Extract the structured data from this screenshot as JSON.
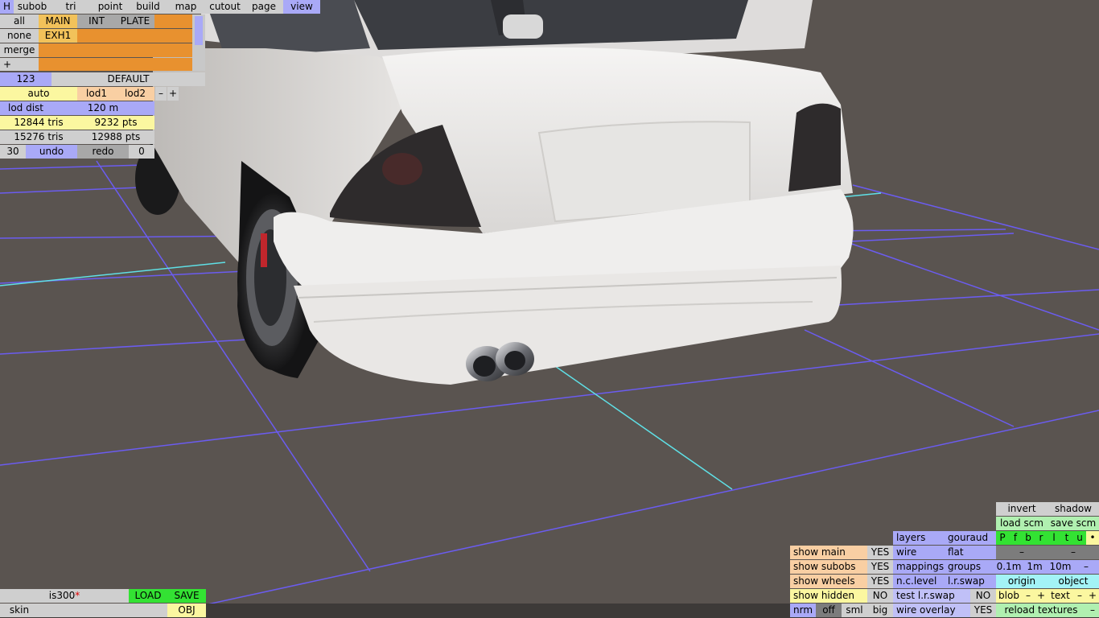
{
  "toolbar": {
    "h": "H",
    "subob": "subob",
    "tri": "tri",
    "point": "point",
    "build": "build",
    "map": "map",
    "cutout": "cutout",
    "page": "page",
    "view": "view"
  },
  "left_panel": {
    "rows": {
      "all": "all",
      "none": "none",
      "merge": "merge",
      "plus": "+",
      "main": "MAIN",
      "int": "INT",
      "plate": "PLATE",
      "exh1": "EXH1"
    },
    "lod_row": {
      "num": "123",
      "name": "DEFAULT"
    },
    "lod_ctrl": {
      "auto": "auto",
      "lod1": "lod1",
      "lod2": "lod2",
      "minus": "–",
      "plus": "+"
    },
    "lod_dist": {
      "label": "lod dist",
      "value": "120 m"
    },
    "stats1": {
      "tris": "12844 tris",
      "pts": "9232 pts"
    },
    "stats2": {
      "tris": "15276 tris",
      "pts": "12988 pts"
    },
    "undo_row": {
      "count": "30",
      "undo": "undo",
      "redo": "redo",
      "redo_count": "0"
    }
  },
  "file_panel": {
    "name": "is300",
    "modified_mark": "*",
    "load": "LOAD",
    "save": "SAVE",
    "skin": "skin",
    "obj": "OBJ"
  },
  "right_panel": {
    "invert": "invert",
    "shadow": "shadow",
    "load_scm": "load scm",
    "save_scm": "save scm",
    "view_letters": [
      "P",
      "f",
      "b",
      "r",
      "l",
      "t",
      "u",
      "•"
    ],
    "layers": "layers",
    "gouraud": "gouraud",
    "wire": "wire",
    "flat": "flat",
    "mappings": "mappings",
    "groups": "groups",
    "ncl": "n.c.level",
    "lrswap": "l.r.swap",
    "test_lrswap": "test l.r.swap",
    "test_lrswap_val": "NO",
    "wire_overlay": "wire overlay",
    "wire_overlay_val": "YES",
    "dash1": "–",
    "dash2": "–",
    "grid": [
      "0.1m",
      "1m",
      "10m",
      "–"
    ],
    "origin": "origin",
    "object": "object",
    "blob": "blob",
    "text": "text",
    "reload": "reload textures",
    "minus": "–",
    "plus": "+",
    "show_main": "show main",
    "show_main_val": "YES",
    "show_subobs": "show subobs",
    "show_subobs_val": "YES",
    "show_wheels": "show wheels",
    "show_wheels_val": "YES",
    "show_hidden": "show hidden",
    "show_hidden_val": "NO",
    "nrm": "nrm",
    "off": "off",
    "sml": "sml",
    "big": "big"
  },
  "colors": {
    "ground": "#5a5450",
    "grid": "#6b5cf0",
    "axis": "#5fe0e6",
    "car_body": "#ecebea"
  }
}
